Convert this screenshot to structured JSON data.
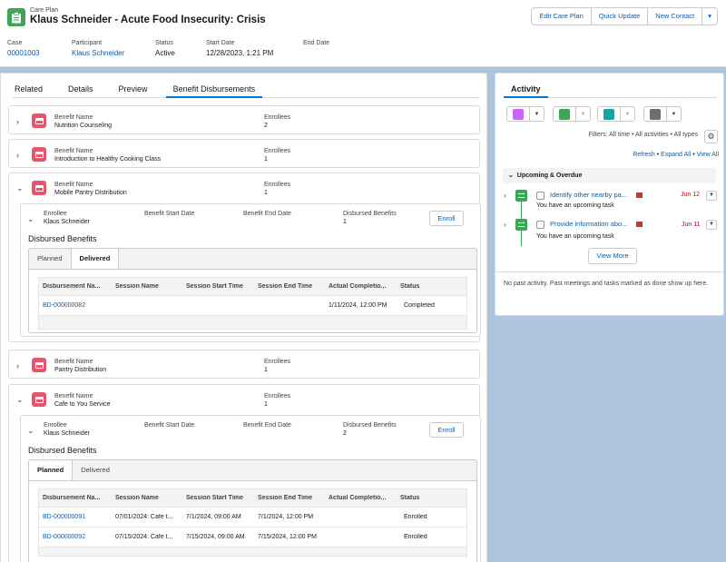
{
  "header": {
    "object_label": "Care Plan",
    "title": "Klaus Schneider - Acute Food Insecurity: Crisis",
    "buttons": [
      "Edit Care Plan",
      "Quick Update",
      "New Contact"
    ],
    "more_icon": "chevron-down-icon",
    "fields": [
      {
        "label": "Case",
        "value": "00001003",
        "link": true
      },
      {
        "label": "Participant",
        "value": "Klaus Schneider",
        "link": true
      },
      {
        "label": "Status",
        "value": "Active",
        "link": false
      },
      {
        "label": "Start Date",
        "value": "12/28/2023, 1:21 PM",
        "link": false
      },
      {
        "label": "End Date",
        "value": "",
        "link": false
      }
    ]
  },
  "tabs": [
    "Related",
    "Details",
    "Preview",
    "Benefit Disbursements"
  ],
  "active_tab": "Benefit Disbursements",
  "labels": {
    "benefit_name": "Benefit Name",
    "enrollees": "Enrollees",
    "enrollee": "Enrollee",
    "benefit_start": "Benefit Start Date",
    "benefit_end": "Benefit End Date",
    "disbursed": "Disbursed Benefits",
    "enroll_button": "Enroll",
    "disbursed_title": "Disbursed Benefits",
    "tab_planned": "Planned",
    "tab_delivered": "Delivered"
  },
  "table_columns": [
    "Disbursement Na...",
    "Session Name",
    "Session Start Time",
    "Session End Time",
    "Actual Completio...",
    "Status"
  ],
  "benefits": [
    {
      "name": "Nutrition Counseling",
      "enrollees": "2"
    },
    {
      "name": "Introduction to Healthy Cooking Class",
      "enrollees": "1"
    },
    {
      "name": "Mobile Pantry Distribution",
      "enrollees": "1",
      "enrollee": {
        "name": "Klaus Schneider",
        "start": "",
        "end": "",
        "disbursed": "1",
        "active_subtab": "Delivered",
        "rows": [
          [
            "BD-000000082",
            "",
            "",
            "",
            "1/11/2024, 12:00 PM",
            "Completed"
          ]
        ]
      }
    },
    {
      "name": "Pantry Distribution",
      "enrollees": "1"
    },
    {
      "name": "Cafe to You Service",
      "enrollees": "1",
      "enrollee": {
        "name": "Klaus Schneider",
        "start": "",
        "end": "",
        "disbursed": "2",
        "active_subtab": "Planned",
        "rows": [
          [
            "BD-000000091",
            "07/01/2024: Cafe t...",
            "7/1/2024, 09:00 AM",
            "7/1/2024, 12:00 PM",
            "",
            "Enrolled"
          ],
          [
            "BD-000000092",
            "07/15/2024: Cafe t...",
            "7/15/2024, 09:00 AM",
            "7/15/2024, 12:00 PM",
            "",
            "Enrolled"
          ]
        ]
      }
    }
  ],
  "activity": {
    "title": "Activity",
    "action_icons": [
      {
        "name": "event-icon",
        "color": "#cb65ff"
      },
      {
        "name": "task-icon",
        "color": "#3ba755"
      },
      {
        "name": "call-icon",
        "color": "#16a4a1"
      },
      {
        "name": "email-icon",
        "color": "#706e6b"
      }
    ],
    "filters": "Filters: All time • All activities • All types",
    "links": [
      "Refresh",
      "Expand All",
      "View All"
    ],
    "section": "Upcoming & Overdue",
    "tasks": [
      {
        "subject": "Identify other nearby pa...",
        "desc": "You have an upcoming task",
        "due": "Jun 12"
      },
      {
        "subject": "Provide information abo...",
        "desc": "You have an upcoming task",
        "due": "Jun 11"
      }
    ],
    "view_more": "View More",
    "empty_past": "No past activity. Past meetings and tasks marked as done show up here."
  }
}
